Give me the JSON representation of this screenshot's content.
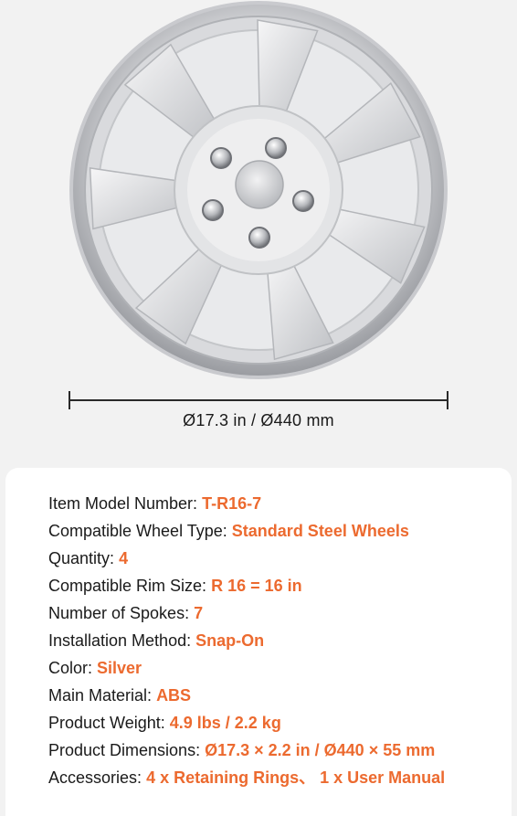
{
  "dimension_label": "Ø17.3  in / Ø440  mm",
  "specs": [
    {
      "label": "Item Model Number:",
      "value": "T-R16-7"
    },
    {
      "label": "Compatible Wheel Type:",
      "value": "Standard Steel Wheels"
    },
    {
      "label": "Quantity:",
      "value": "4"
    },
    {
      "label": "Compatible Rim Size:",
      "value": "R 16 = 16 in"
    },
    {
      "label": "Number of Spokes:",
      "value": "7"
    },
    {
      "label": "Installation Method:",
      "value": "Snap-On"
    },
    {
      "label": "Color:",
      "value": "Silver"
    },
    {
      "label": "Main Material:",
      "value": "ABS"
    },
    {
      "label": "Product Weight:",
      "value": "4.9 lbs / 2.2 kg"
    },
    {
      "label": "Product Dimensions:",
      "value": "Ø17.3 × 2.2 in / Ø440 × 55 mm"
    },
    {
      "label": "Accessories:",
      "value": "4 x Retaining Rings、 1 x User Manual"
    }
  ],
  "colors": {
    "accent": "#ec6a2f",
    "background": "#f2f2f2",
    "card": "#ffffff",
    "text": "#1a1a1a"
  }
}
